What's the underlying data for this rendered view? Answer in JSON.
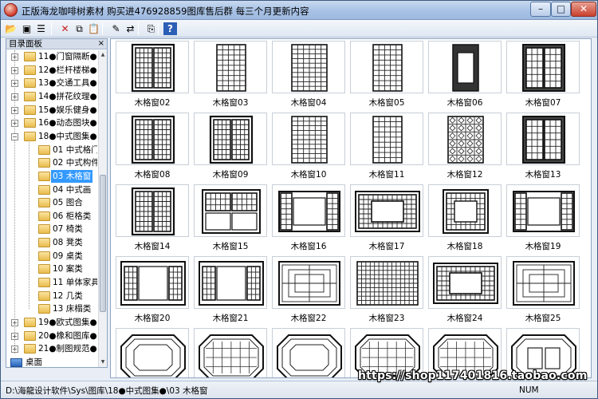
{
  "window": {
    "title": "正版海龙咖啡树素材 购买进476928859图库售后群 每三个月更新内容",
    "icon": "app-logo-icon",
    "controls": {
      "minimize": "–",
      "maximize": "□",
      "close": "✕"
    }
  },
  "toolbar": {
    "buttons": [
      {
        "name": "open-folder-icon",
        "glyph": "📂"
      },
      {
        "name": "image-view-icon",
        "glyph": "▣"
      },
      {
        "name": "list-view-icon",
        "glyph": "☰"
      },
      {
        "name": "delete-icon",
        "glyph": "✕"
      },
      {
        "name": "copy-icon",
        "glyph": "⧉"
      },
      {
        "name": "paste-icon",
        "glyph": "📋"
      },
      {
        "name": "edit-icon",
        "glyph": "✎"
      },
      {
        "name": "rename-icon",
        "glyph": "⇄"
      },
      {
        "name": "properties-icon",
        "glyph": "⎘"
      },
      {
        "name": "help-icon",
        "glyph": "?"
      }
    ]
  },
  "sidebar": {
    "header": "目录面板",
    "close_glyph": "×",
    "items": [
      {
        "label": "11●门窗隔断●",
        "level": 0,
        "expander": "+"
      },
      {
        "label": "12●栏杆楼梯●",
        "level": 0,
        "expander": "+"
      },
      {
        "label": "13●交通工具●",
        "level": 0,
        "expander": "+"
      },
      {
        "label": "14●拼花纹理●",
        "level": 0,
        "expander": "+"
      },
      {
        "label": "15●娱乐健身●",
        "level": 0,
        "expander": "+"
      },
      {
        "label": "16●动态图块●",
        "level": 0,
        "expander": "+"
      },
      {
        "label": "18●中式图集●",
        "level": 0,
        "expander": "−"
      },
      {
        "label": "01 中式格门",
        "level": 1
      },
      {
        "label": "02 中式构件",
        "level": 1
      },
      {
        "label": "03 木格窗",
        "level": 1,
        "selected": true
      },
      {
        "label": "04 中式画",
        "level": 1
      },
      {
        "label": "05 图合",
        "level": 1
      },
      {
        "label": "06 柜格类",
        "level": 1
      },
      {
        "label": "07 椅类",
        "level": 1
      },
      {
        "label": "08 凳类",
        "level": 1
      },
      {
        "label": "09 桌类",
        "level": 1
      },
      {
        "label": "10 案类",
        "level": 1
      },
      {
        "label": "11 单体家具",
        "level": 1
      },
      {
        "label": "12 几类",
        "level": 1
      },
      {
        "label": "13 床榻类",
        "level": 1
      },
      {
        "label": "19●欧式图集●",
        "level": 0,
        "expander": "+"
      },
      {
        "label": "20●橡和图库●",
        "level": 0,
        "expander": "+"
      },
      {
        "label": "21●制图规范●",
        "level": 0,
        "expander": "+"
      },
      {
        "label": "桌面",
        "level": -1,
        "desktop": true
      }
    ]
  },
  "gallery": {
    "items": [
      {
        "label": "木格窗02",
        "pattern": "double-lattice"
      },
      {
        "label": "木格窗03",
        "pattern": "grid-tall"
      },
      {
        "label": "木格窗04",
        "pattern": "grid-dense"
      },
      {
        "label": "木格窗05",
        "pattern": "grid-tall"
      },
      {
        "label": "木格窗06",
        "pattern": "frame-center"
      },
      {
        "label": "木格窗07",
        "pattern": "double-dark"
      },
      {
        "label": "木格窗08",
        "pattern": "double-lattice"
      },
      {
        "label": "木格窗09",
        "pattern": "double-lattice"
      },
      {
        "label": "木格窗10",
        "pattern": "grid-dense"
      },
      {
        "label": "木格窗11",
        "pattern": "grid-tall"
      },
      {
        "label": "木格窗12",
        "pattern": "diamond"
      },
      {
        "label": "木格窗13",
        "pattern": "double-dark"
      },
      {
        "label": "木格窗14",
        "pattern": "double-lattice"
      },
      {
        "label": "木格窗15",
        "pattern": "double-panel"
      },
      {
        "label": "木格窗16",
        "pattern": "wide-center"
      },
      {
        "label": "木格窗17",
        "pattern": "wide-ornate"
      },
      {
        "label": "木格窗18",
        "pattern": "square-center"
      },
      {
        "label": "木格窗19",
        "pattern": "wide-center"
      },
      {
        "label": "木格窗20",
        "pattern": "side-panels"
      },
      {
        "label": "木格窗21",
        "pattern": "side-panels"
      },
      {
        "label": "木格窗22",
        "pattern": "fret-wide"
      },
      {
        "label": "木格窗23",
        "pattern": "grid-wide"
      },
      {
        "label": "木格窗24",
        "pattern": "wide-ornate"
      },
      {
        "label": "木格窗25",
        "pattern": "fret-wide"
      },
      {
        "label": "",
        "pattern": "octagon"
      },
      {
        "label": "",
        "pattern": "octagon-fret"
      },
      {
        "label": "",
        "pattern": "octagon"
      },
      {
        "label": "",
        "pattern": "octagon-fret"
      },
      {
        "label": "",
        "pattern": "octagon-fret"
      },
      {
        "label": "",
        "pattern": "octagon-double"
      }
    ]
  },
  "statusbar": {
    "path": "D:\\海龍设计软件\\Sys\\图库\\18●中式图集●\\03 木格窗",
    "num": "NUM"
  },
  "watermark": "https://shop117401816.taobao.com",
  "colors": {
    "selection": "#3399ff",
    "folder": "#e9bd4d",
    "close_button": "#c8412c"
  }
}
